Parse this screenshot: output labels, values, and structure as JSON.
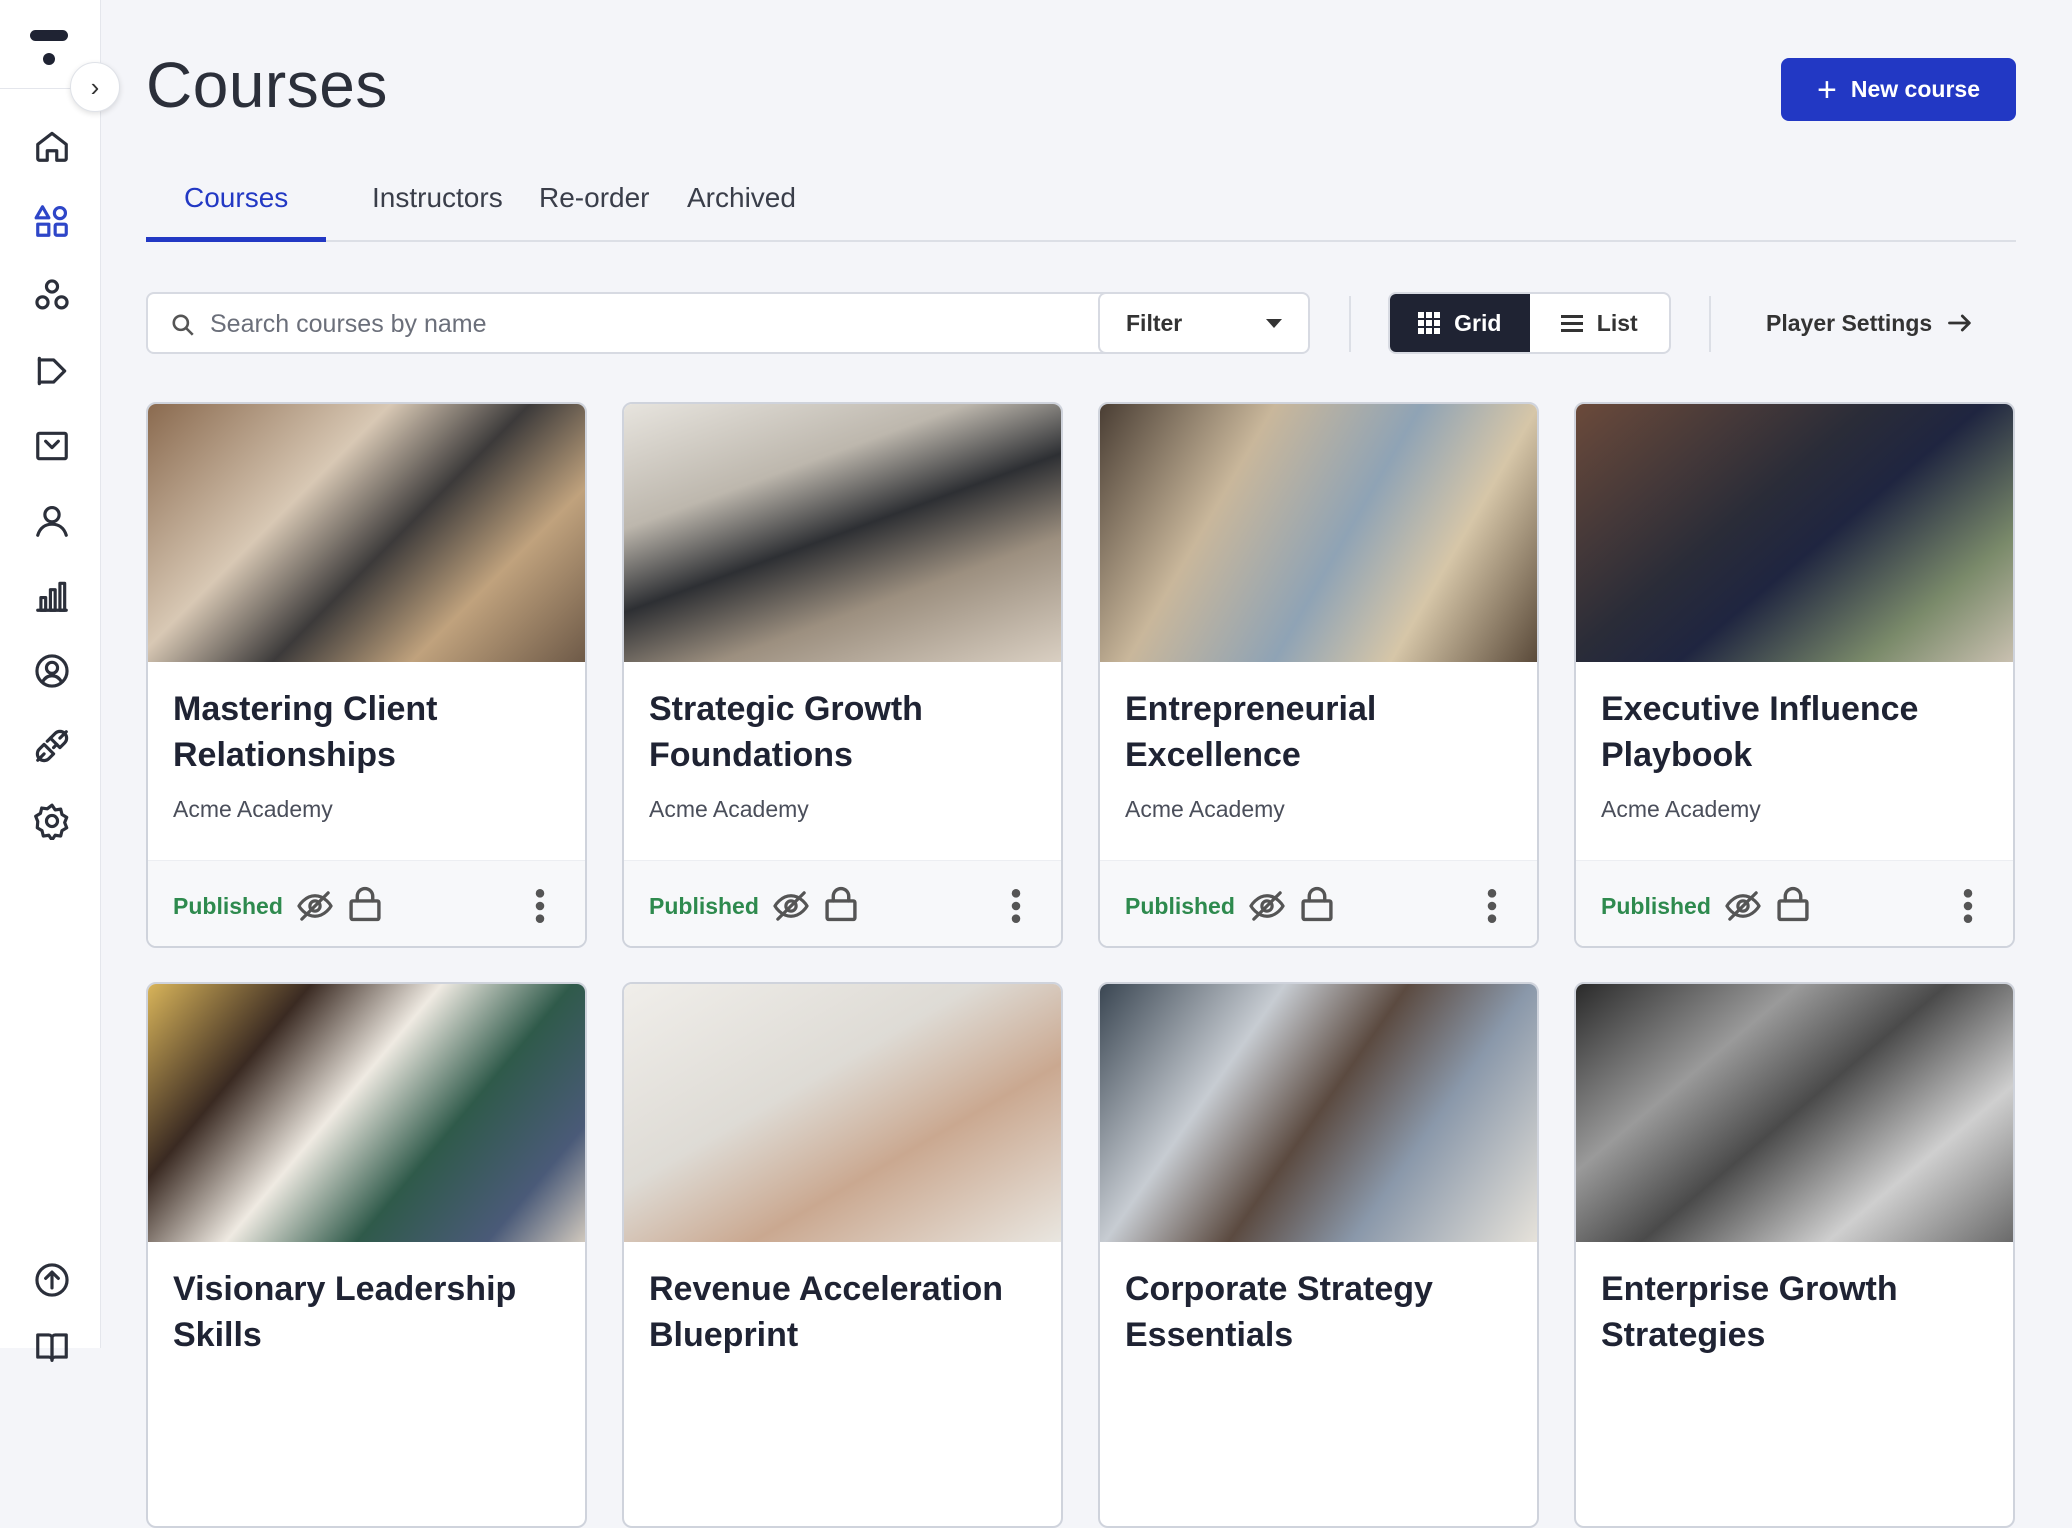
{
  "page": {
    "title": "Courses",
    "new_course_label": "New course"
  },
  "tabs": [
    {
      "label": "Courses",
      "active": true
    },
    {
      "label": "Instructors",
      "active": false
    },
    {
      "label": "Re-order",
      "active": false
    },
    {
      "label": "Archived",
      "active": false
    }
  ],
  "toolbar": {
    "search_placeholder": "Search courses by name",
    "filter_label": "Filter",
    "grid_label": "Grid",
    "list_label": "List",
    "player_settings_label": "Player Settings",
    "view_mode": "grid"
  },
  "sidebar": {
    "items": [
      "home-icon",
      "shapes-icon",
      "community-icon",
      "megaphone-icon",
      "inbox-icon",
      "user-icon",
      "analytics-icon",
      "account-circle-icon",
      "integrations-icon",
      "settings-icon",
      "upload-icon",
      "book-icon"
    ],
    "active": "shapes-icon"
  },
  "courses": [
    {
      "title": "Mastering Client Relationships",
      "author": "Acme Academy",
      "status": "Published"
    },
    {
      "title": "Strategic Growth Foundations",
      "author": "Acme Academy",
      "status": "Published"
    },
    {
      "title": "Entrepreneurial Excellence",
      "author": "Acme Academy",
      "status": "Published"
    },
    {
      "title": "Executive Influence Playbook",
      "author": "Acme Academy",
      "status": "Published"
    },
    {
      "title": "Visionary Leadership Skills",
      "author": "",
      "status": ""
    },
    {
      "title": "Revenue Acceleration Blueprint",
      "author": "",
      "status": ""
    },
    {
      "title": "Corporate Strategy Essentials",
      "author": "",
      "status": ""
    },
    {
      "title": "Enterprise Growth Strategies",
      "author": "",
      "status": ""
    }
  ],
  "colors": {
    "accent": "#2238c4",
    "published": "#2e8a4e",
    "dark": "#1f2333"
  }
}
